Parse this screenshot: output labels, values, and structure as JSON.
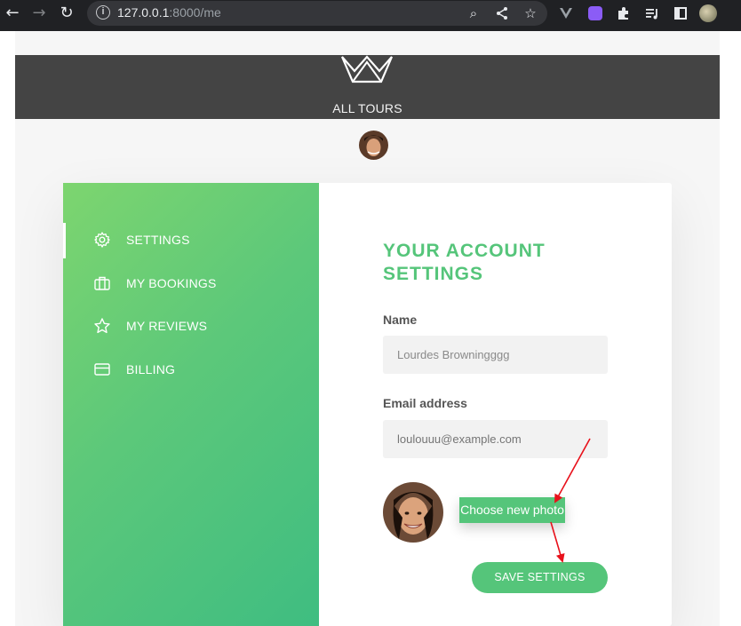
{
  "browser": {
    "url_host": "127.0.0.1",
    "url_rest": ":8000/me",
    "icons": [
      "back-icon",
      "forward-icon",
      "reload-icon",
      "info-icon",
      "zoom-icon",
      "share-icon",
      "bookmark-star-icon",
      "vue-devtools-icon",
      "extension-icon",
      "puzzle-icon",
      "media-icon",
      "sidepanel-icon",
      "profile-icon"
    ]
  },
  "header": {
    "nav_label": "ALL TOURS"
  },
  "sidebar": {
    "items": [
      {
        "label": "SETTINGS",
        "icon": "gear-icon"
      },
      {
        "label": "MY BOOKINGS",
        "icon": "briefcase-icon"
      },
      {
        "label": "MY REVIEWS",
        "icon": "star-icon"
      },
      {
        "label": "BILLING",
        "icon": "credit-card-icon"
      }
    ]
  },
  "settings": {
    "title": "YOUR ACCOUNT SETTINGS",
    "name_label": "Name",
    "name_value": "Lourdes Browningggg",
    "email_label": "Email address",
    "email_placeholder": "loulouuu@example.com",
    "choose_photo": "Choose new photo",
    "save_label": "SAVE SETTINGS"
  },
  "colors": {
    "accent": "#55c57a",
    "header_bg": "#444444",
    "annotation": "#e8111b"
  }
}
